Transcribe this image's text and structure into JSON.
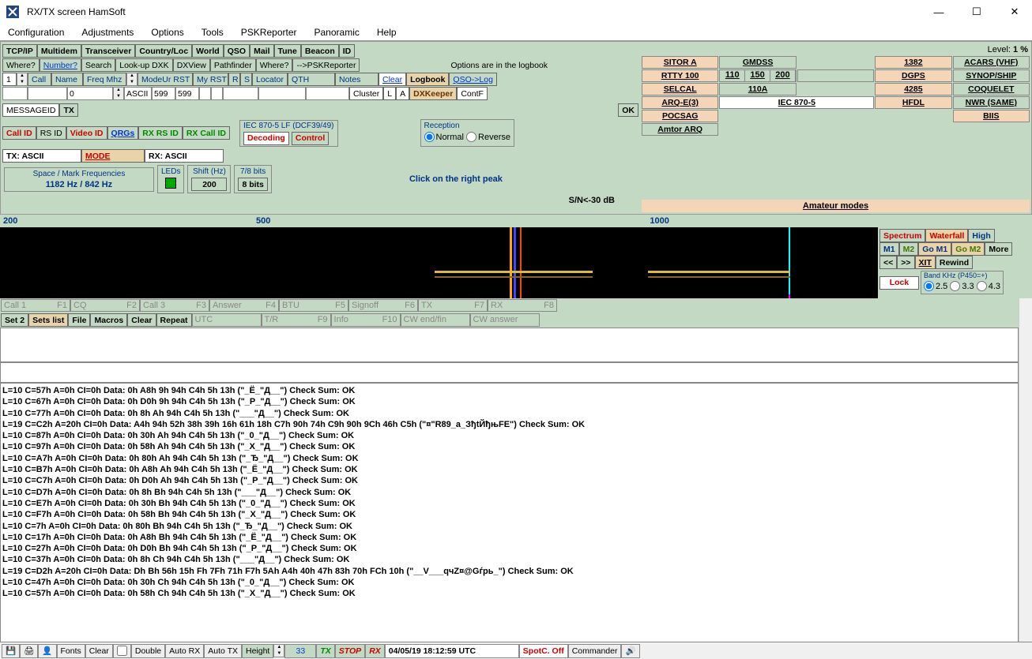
{
  "title": "RX/TX screen  HamSoft",
  "menubar": [
    "Configuration",
    "Adjustments",
    "Options",
    "Tools",
    "PSKReporter",
    "Panoramic",
    "Help"
  ],
  "toolbar1": [
    "TCP/IP",
    "Multidem",
    "Transceiver",
    "Country/Loc",
    "World",
    "QSO",
    "Mail",
    "Tune",
    "Beacon",
    "ID"
  ],
  "level_label": "Level:",
  "level_value": "1 %",
  "toolbar2": [
    "Where?",
    "Number?",
    "Search",
    "Look-up DXK",
    "DXView",
    "Pathfinder",
    "Where?",
    "-->PSKReporter"
  ],
  "logbook_text": "Options are in the logbook",
  "header_row": {
    "num": "1",
    "call": "Call",
    "name": "Name",
    "freq": "Freq Mhz",
    "mode": "ModeUr RST",
    "myrst": "My RST",
    "r": "R",
    "s": "S",
    "locator": "Locator",
    "qth": "QTH",
    "notes": "Notes",
    "clear": "Clear",
    "logbook": "Logbook",
    "qsolog": "QSO->Log"
  },
  "input_row": {
    "freq": "0",
    "ascii": "ASCII",
    "rst1": "599",
    "rst2": "599",
    "cluster": "Cluster",
    "l": "L",
    "a": "A",
    "dxk": "DXKeeper",
    "contf": "ContF"
  },
  "messageid": "MESSAGEID",
  "tx": "TX",
  "ok": "OK",
  "id_row": [
    "Call ID",
    "RS ID",
    "Video ID",
    "QRGs",
    "RX RS ID",
    "RX Call ID"
  ],
  "mode_panel": {
    "title": "IEC 870-5 LF (DCF39/49)",
    "decoding": "Decoding",
    "control": "Control"
  },
  "tx_ascii": "TX: ASCII",
  "mode_btn": "MODE",
  "rx_ascii": "RX: ASCII",
  "reception": {
    "title": "Reception",
    "normal": "Normal",
    "reverse": "Reverse"
  },
  "freq_panel": {
    "title": "Space / Mark Frequencies",
    "value": "1182 Hz / 842 Hz"
  },
  "leds": "LEDs",
  "shift": {
    "title": "Shift (Hz)",
    "value": "200"
  },
  "bits": {
    "title": "7/8 bits",
    "value": "8 bits"
  },
  "peak_text": "Click on the right peak",
  "sn_text": "S/N<-30 dB",
  "amateur": "Amateur modes",
  "modes": [
    [
      "SITOR A",
      "GMDSS",
      "1382",
      "ACARS (VHF)"
    ],
    [
      "RTTY 100",
      "110 150 200",
      "DGPS",
      "SYNOP/SHIP"
    ],
    [
      "SELCAL",
      "110A",
      "4285",
      "COQUELET"
    ],
    [
      "ARQ-E(3)",
      "IEC 870-5",
      "HFDL",
      "NWR (SAME)"
    ],
    [
      "POCSAG",
      "",
      "BIIS",
      "Amtor ARQ"
    ]
  ],
  "scale": [
    "200",
    "500",
    "1000"
  ],
  "wf_right": {
    "spectrum": "Spectrum",
    "waterfall": "Waterfall",
    "high": "High",
    "m1": "M1",
    "m2": "M2",
    "gom1": "Go M1",
    "gom2": "Go M2",
    "more": "More",
    "back": "<<",
    "fwd": ">>",
    "xit": "XIT",
    "rewind": "Rewind",
    "lock": "Lock",
    "band": "Band KHz (P450=+)",
    "r1": "2.5",
    "r2": "3.3",
    "r3": "4.3"
  },
  "fn1": [
    [
      "Call 1",
      "F1"
    ],
    [
      "CQ",
      "F2"
    ],
    [
      "Call 3",
      "F3"
    ],
    [
      "Answer",
      "F4"
    ],
    [
      "BTU",
      "F5"
    ],
    [
      "Signoff",
      "F6"
    ],
    [
      "TX",
      "F7"
    ],
    [
      "RX",
      "F8"
    ]
  ],
  "fn2_left": [
    "Set 2",
    "Sets list",
    "File",
    "Macros",
    "Clear",
    "Repeat"
  ],
  "fn2": [
    [
      "UTC",
      ""
    ],
    [
      "T/R",
      "F9"
    ],
    [
      "Info",
      "F10"
    ],
    [
      "CW end/fin",
      ""
    ],
    [
      "CW answer",
      ""
    ]
  ],
  "decode_lines": [
    "L=10  C=57h  A=0h  CI=0h  Data: 0h A8h 9h 94h C4h 5h 13h  (\"_Ё_\"Д__\")  Check Sum: OK",
    "L=10  C=67h  A=0h  CI=0h  Data: 0h D0h 9h 94h C4h 5h 13h  (\"_Р_\"Д__\")  Check Sum: OK",
    "L=10  C=77h  A=0h  CI=0h  Data: 0h 8h Ah 94h C4h 5h 13h  (\"___\"Д__\")  Check Sum: OK",
    "L=19  C=C2h  A=20h  CI=0h  Data: A4h 94h 52h 38h 39h 16h 61h 18h C7h 90h 74h C9h 90h 9Ch 46h C5h  (\"¤\"R89_a_ЗђtЙђњFE\")  Check Sum: OK",
    "L=10  C=87h  A=0h  CI=0h  Data: 0h 30h Ah 94h C4h 5h 13h  (\"_0_\"Д__\")  Check Sum: OK",
    "L=10  C=97h  A=0h  CI=0h  Data: 0h 58h Ah 94h C4h 5h 13h  (\"_X_\"Д__\")  Check Sum: OK",
    "L=10  C=A7h  A=0h  CI=0h  Data: 0h 80h Ah 94h C4h 5h 13h  (\"_Ђ_\"Д__\")  Check Sum: OK",
    "L=10  C=B7h  A=0h  CI=0h  Data: 0h A8h Ah 94h C4h 5h 13h  (\"_Ё_\"Д__\")  Check Sum: OK",
    "L=10  C=C7h  A=0h  CI=0h  Data: 0h D0h Ah 94h C4h 5h 13h  (\"_Р_\"Д__\")  Check Sum: OK",
    "L=10  C=D7h  A=0h  CI=0h  Data: 0h 8h Bh 94h C4h 5h 13h  (\"___\"Д__\")  Check Sum: OK",
    "L=10  C=E7h  A=0h  CI=0h  Data: 0h 30h Bh 94h C4h 5h 13h  (\"_0_\"Д__\")  Check Sum: OK",
    "L=10  C=F7h  A=0h  CI=0h  Data: 0h 58h Bh 94h C4h 5h 13h  (\"_X_\"Д__\")  Check Sum: OK",
    "L=10  C=7h  A=0h  CI=0h  Data: 0h 80h Bh 94h C4h 5h 13h  (\"_Ђ_\"Д__\")  Check Sum: OK",
    "L=10  C=17h  A=0h  CI=0h  Data: 0h A8h Bh 94h C4h 5h 13h  (\"_Ё_\"Д__\")  Check Sum: OK",
    "L=10  C=27h  A=0h  CI=0h  Data: 0h D0h Bh 94h C4h 5h 13h  (\"_Р_\"Д__\")  Check Sum: OK",
    "L=10  C=37h  A=0h  CI=0h  Data: 0h 8h Ch 94h C4h 5h 13h  (\"___\"Д__\")  Check Sum: OK",
    "L=19  C=D2h  A=20h  CI=0h  Data: Dh Bh 56h 15h Fh 7Fh 71h F7h 5Ah A4h 40h 47h 83h 70h FCh 10h  (\"__V___qчZ¤@Gѓpь_\")  Check Sum: OK",
    "L=10  C=47h  A=0h  CI=0h  Data: 0h 30h Ch 94h C4h 5h 13h  (\"_0_\"Д__\")  Check Sum: OK",
    "L=10  C=57h  A=0h  CI=0h  Data: 0h 58h Ch 94h C4h 5h 13h  (\"_X_\"Д__\")  Check Sum: OK"
  ],
  "status": {
    "fonts": "Fonts",
    "clear": "Clear",
    "double": "Double",
    "autorx": "Auto RX",
    "autotx": "Auto TX",
    "height": "Height",
    "height_val": "33",
    "tx": "TX",
    "stop": "STOP",
    "rx": "RX",
    "datetime": "04/05/19 18:12:59 UTC",
    "spotc": "SpotC. Off",
    "commander": "Commander"
  }
}
